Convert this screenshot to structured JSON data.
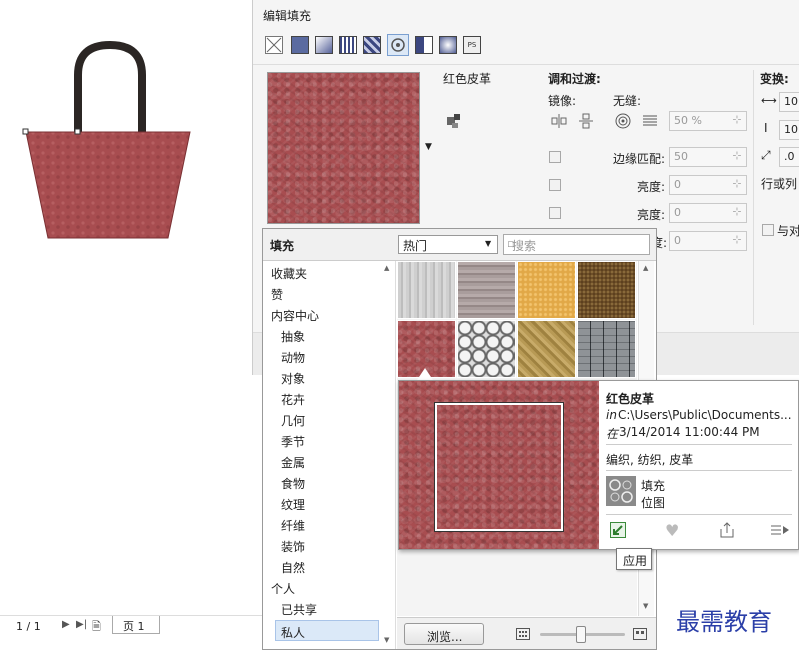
{
  "dialog": {
    "title": "编辑填充",
    "fill_name": "红色皮革",
    "blend_header": "调和过渡:",
    "mirror_label": "镜像:",
    "seamless_label": "无缝:",
    "seamless_value": "50 %",
    "edge_match_label": "边缘匹配:",
    "edge_match_value": "50",
    "brightness_label": "亮度:",
    "brightness_value": "0",
    "brightness2_label": "亮度:",
    "brightness2_value": "0",
    "partial_label": "度:",
    "partial_value": "0",
    "transform_header": "变换:",
    "transform_w": "10",
    "transform_h": "10",
    "transform_angle": ".0",
    "row_col_label": "行或列",
    "with_label": "与对"
  },
  "popup": {
    "header": "填充",
    "dropdown_value": "热门",
    "search_placeholder": "搜索",
    "categories": [
      "收藏夹",
      "赞",
      "内容中心",
      "抽象",
      "动物",
      "对象",
      "花卉",
      "几何",
      "季节",
      "金属",
      "食物",
      "纹理",
      "纤维",
      "装饰",
      "自然",
      "个人",
      "已共享",
      "私人"
    ],
    "browse_button": "浏览..."
  },
  "preview": {
    "name": "红色皮革",
    "path_prefix": "in",
    "path": "C:\\Users\\Public\\Documents...",
    "date_prefix": "在",
    "date": "3/14/2014 11:00:44 PM",
    "tags": "编织, 纺织, 皮革",
    "type1": "填充",
    "type2": "位图",
    "tooltip": "应用"
  },
  "statusbar": {
    "page_count": "1 / 1",
    "page_tab": "页 1"
  },
  "watermark": "最需教育",
  "colors": {
    "leather": "#a84d50",
    "handle": "#2b2624",
    "dialog_bg": "#f5f5f5",
    "selected_bg": "#dbe9f8"
  }
}
